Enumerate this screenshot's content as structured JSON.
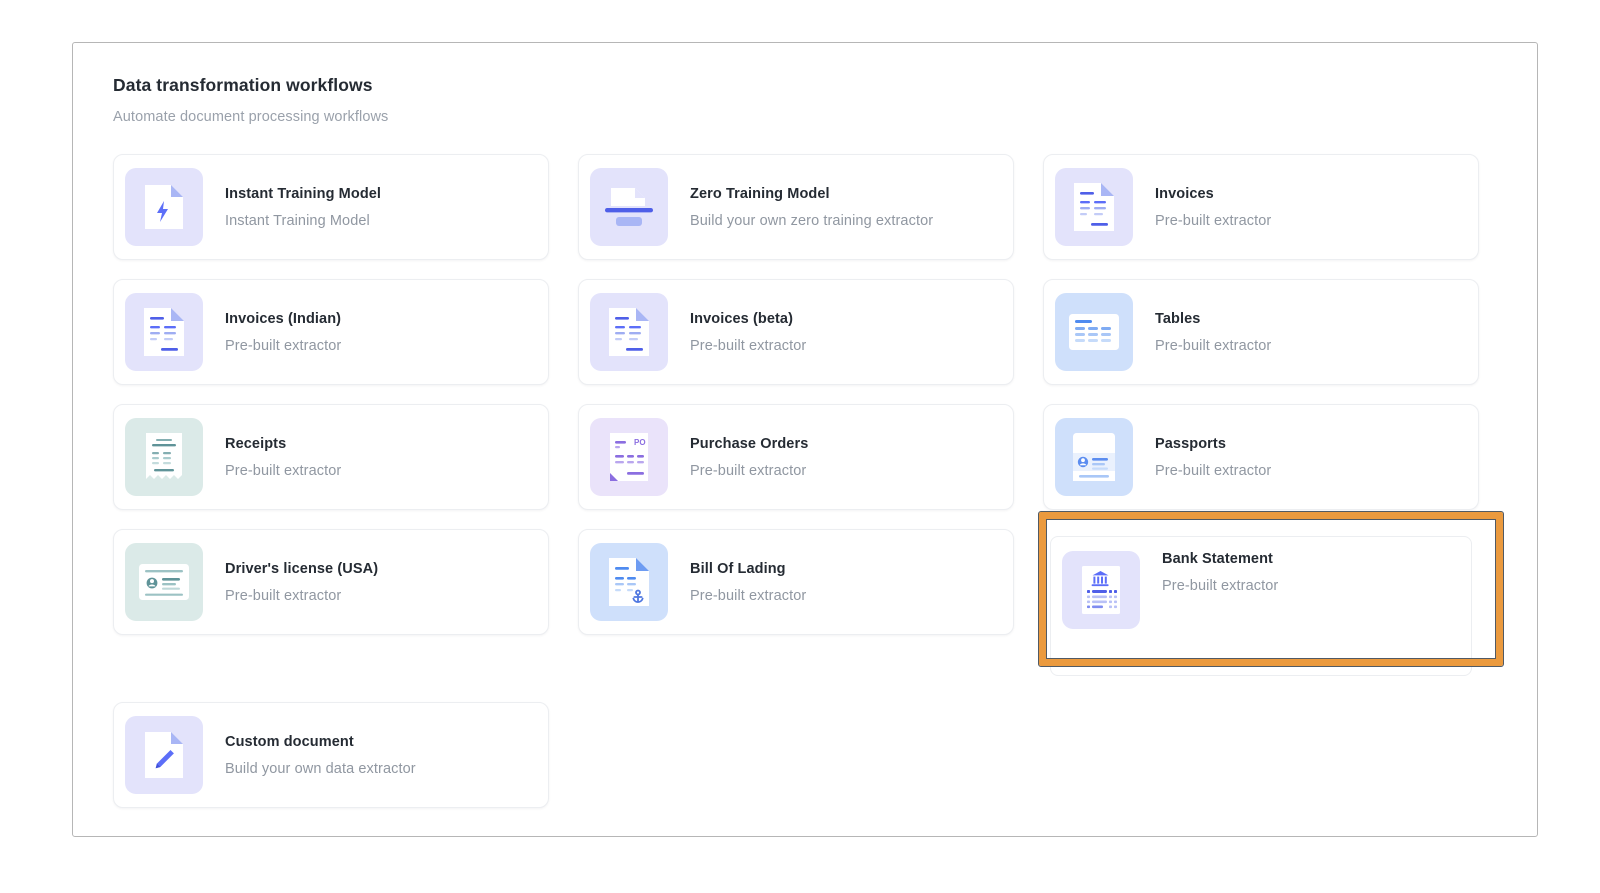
{
  "header": {
    "title": "Data transformation workflows",
    "subtitle": "Automate document processing workflows"
  },
  "colors": {
    "highlight_border": "#eb9a3e",
    "highlight_outline": "#515a64",
    "title_text": "#252b33",
    "subtitle_text": "#9aa1ab",
    "accent_blue": "#5c6ef8",
    "accent_teal": "#7da9ac",
    "accent_purple": "#8b6ee0",
    "panel_border": "#b6b6b6",
    "card_border": "#eceef1"
  },
  "cards": [
    {
      "title": "Instant Training Model",
      "subtitle": "Instant Training Model",
      "icon": "document-bolt-icon",
      "thumb_class": "bg-lav",
      "selected": false
    },
    {
      "title": "Zero Training Model",
      "subtitle": "Build your own zero training extractor",
      "icon": "document-scanner-icon",
      "thumb_class": "bg-lav",
      "selected": false
    },
    {
      "title": "Invoices",
      "subtitle": "Pre-built extractor",
      "icon": "invoice-document-icon",
      "thumb_class": "bg-lav",
      "selected": false
    },
    {
      "title": "Invoices (Indian)",
      "subtitle": "Pre-built extractor",
      "icon": "invoice-document-icon",
      "thumb_class": "bg-lav",
      "selected": false
    },
    {
      "title": "Invoices (beta)",
      "subtitle": "Pre-built extractor",
      "icon": "invoice-document-icon",
      "thumb_class": "bg-lav",
      "selected": false
    },
    {
      "title": "Tables",
      "subtitle": "Pre-built extractor",
      "icon": "table-grid-icon",
      "thumb_class": "bg-blue",
      "selected": false
    },
    {
      "title": "Receipts",
      "subtitle": "Pre-built extractor",
      "icon": "receipt-icon",
      "thumb_class": "bg-mint",
      "selected": false
    },
    {
      "title": "Purchase Orders",
      "subtitle": "Pre-built extractor",
      "icon": "purchase-order-icon",
      "thumb_class": "bg-purp",
      "selected": false
    },
    {
      "title": "Passports",
      "subtitle": "Pre-built extractor",
      "icon": "passport-icon",
      "thumb_class": "bg-blue",
      "selected": false
    },
    {
      "title": "Driver's license (USA)",
      "subtitle": "Pre-built extractor",
      "icon": "id-card-icon",
      "thumb_class": "bg-mint",
      "selected": false
    },
    {
      "title": "Bill Of Lading",
      "subtitle": "Pre-built extractor",
      "icon": "document-anchor-icon",
      "thumb_class": "bg-blue",
      "selected": false
    },
    {
      "title": "Bank Statement",
      "subtitle": "Pre-built extractor",
      "icon": "bank-statement-icon",
      "thumb_class": "bg-lav",
      "selected": true
    },
    {
      "title": "Custom document",
      "subtitle": "Build your own data extractor",
      "icon": "document-pencil-icon",
      "thumb_class": "bg-lav",
      "selected": false
    }
  ],
  "icon_label": {
    "purchase_order_text": "PO"
  }
}
